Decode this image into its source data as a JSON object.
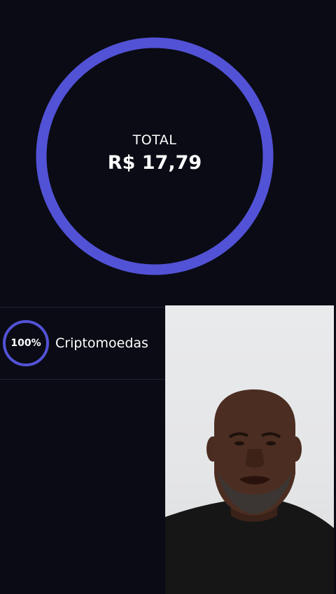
{
  "summary": {
    "total_label": "TOTAL",
    "total_value": "R$ 17,79"
  },
  "allocation": {
    "items": [
      {
        "percent_label": "100%",
        "category": "Criptomoedas",
        "share": 1.0
      }
    ]
  },
  "colors": {
    "background": "#0a0b14",
    "accent": "#5252d6",
    "text": "#ffffff",
    "divider": "#1f2130"
  },
  "overlay": {
    "type": "webcam-video"
  }
}
